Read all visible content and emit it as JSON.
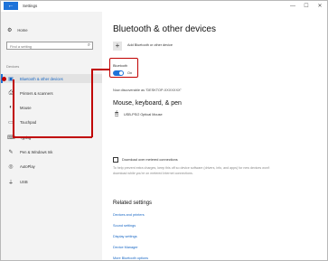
{
  "window": {
    "title": "Settings",
    "back_glyph": "←",
    "controls": {
      "minimize": "—",
      "maximize": "☐",
      "close": "✕"
    }
  },
  "sidebar": {
    "home": {
      "icon": "gear-icon",
      "glyph": "⚙",
      "label": "Home"
    },
    "search_placeholder": "Find a setting",
    "search_icon": "⌕",
    "header": "Devices",
    "items": [
      {
        "id": "bluetooth",
        "label": "Bluetooth & other devices",
        "icon": "bluetooth-icon",
        "glyph": "▣",
        "selected": true
      },
      {
        "id": "printers",
        "label": "Printers & scanners",
        "icon": "printer-icon",
        "glyph": "⎙",
        "selected": false
      },
      {
        "id": "mouse",
        "label": "Mouse",
        "icon": "mouse-icon",
        "glyph": "◐",
        "selected": false
      },
      {
        "id": "touchpad",
        "label": "Touchpad",
        "icon": "touchpad-icon",
        "glyph": "▭",
        "selected": false
      },
      {
        "id": "typing",
        "label": "Typing",
        "icon": "keyboard-icon",
        "glyph": "⌨",
        "selected": false
      },
      {
        "id": "pen",
        "label": "Pen & Windows Ink",
        "icon": "pen-icon",
        "glyph": "✎",
        "selected": false
      },
      {
        "id": "autoplay",
        "label": "AutoPlay",
        "icon": "autoplay-icon",
        "glyph": "◎",
        "selected": false
      },
      {
        "id": "usb",
        "label": "USB",
        "icon": "usb-icon",
        "glyph": "⏚",
        "selected": false
      }
    ]
  },
  "main": {
    "title": "Bluetooth & other devices",
    "add_device": {
      "glyph": "+",
      "label": "Add Bluetooth or other device"
    },
    "bluetooth": {
      "label": "Bluetooth",
      "toggle_state": "On",
      "on": true
    },
    "discoverable": "Now discoverable as \"DESKTOP-XXXXXXX\"",
    "section_mouse": "Mouse, keyboard, & pen",
    "device": {
      "icon": "mouse-icon",
      "glyph": "🖱",
      "name": "USB-PS/2 Optical Mouse"
    },
    "metered": {
      "label": "Download over metered connections",
      "checked": false,
      "hint": "To help prevent extra charges, keep this off so device software (drivers, info, and apps) for new devices won't download while you're on metered Internet connections."
    },
    "related_title": "Related settings",
    "related_links": [
      "Devices and printers",
      "Sound settings",
      "Display settings",
      "Device Manager",
      "More Bluetooth options"
    ]
  },
  "colors": {
    "accent": "#1e73d9",
    "highlight": "#c00000"
  }
}
